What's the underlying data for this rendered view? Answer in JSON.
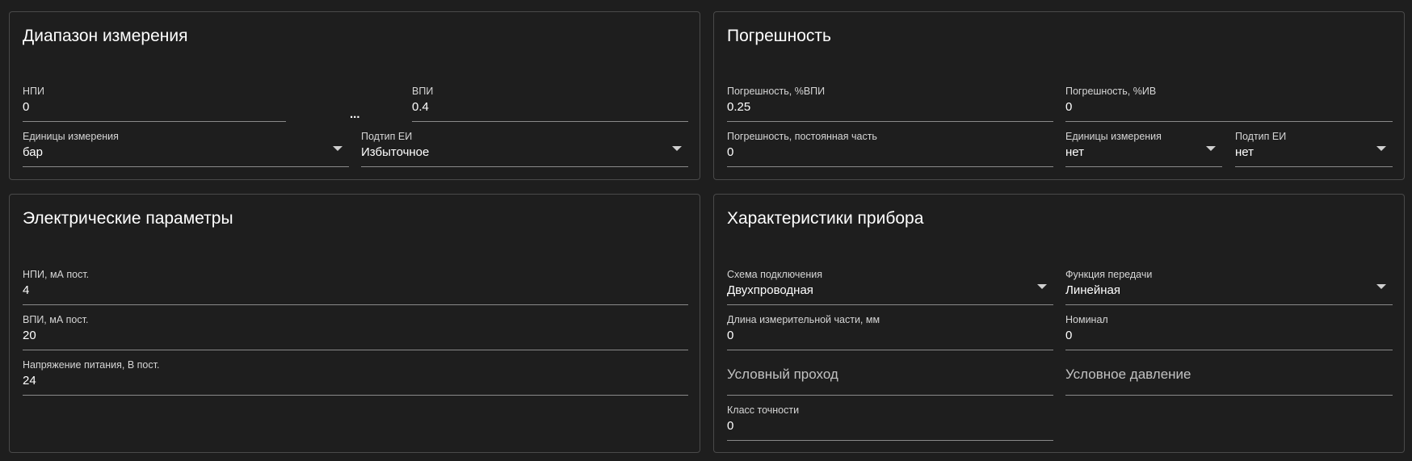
{
  "range": {
    "title": "Диапазон измерения",
    "lower": {
      "label": "НПИ",
      "value": "0"
    },
    "separator": "...",
    "upper": {
      "label": "ВПИ",
      "value": "0.4"
    },
    "units": {
      "label": "Единицы измерения",
      "value": "бар"
    },
    "subtype": {
      "label": "Подтип ЕИ",
      "value": "Избыточное"
    }
  },
  "error": {
    "title": "Погрешность",
    "percent_upper": {
      "label": "Погрешность, %ВПИ",
      "value": "0.25"
    },
    "percent_measured": {
      "label": "Погрешность, %ИВ",
      "value": "0"
    },
    "constant": {
      "label": "Погрешность, постоянная часть",
      "value": "0"
    },
    "units": {
      "label": "Единицы измерения",
      "value": "нет"
    },
    "subtype": {
      "label": "Подтип ЕИ",
      "value": "нет"
    }
  },
  "electrical": {
    "title": "Электрические параметры",
    "lower_ma": {
      "label": "НПИ, мА пост.",
      "value": "4"
    },
    "upper_ma": {
      "label": "ВПИ, мА пост.",
      "value": "20"
    },
    "supply_voltage": {
      "label": "Напряжение питания, В пост.",
      "value": "24"
    }
  },
  "device": {
    "title": "Характеристики прибора",
    "wiring": {
      "label": "Схема подключения",
      "value": "Двухпроводная"
    },
    "transfer": {
      "label": "Функция передачи",
      "value": "Линейная"
    },
    "length": {
      "label": "Длина измерительной части, мм",
      "value": "0"
    },
    "nominal": {
      "label": "Номинал",
      "value": "0"
    },
    "nominal_bore": {
      "placeholder": "Условный проход"
    },
    "nominal_pressure": {
      "placeholder": "Условное давление"
    },
    "accuracy_class": {
      "label": "Класс точности",
      "value": "0"
    }
  }
}
